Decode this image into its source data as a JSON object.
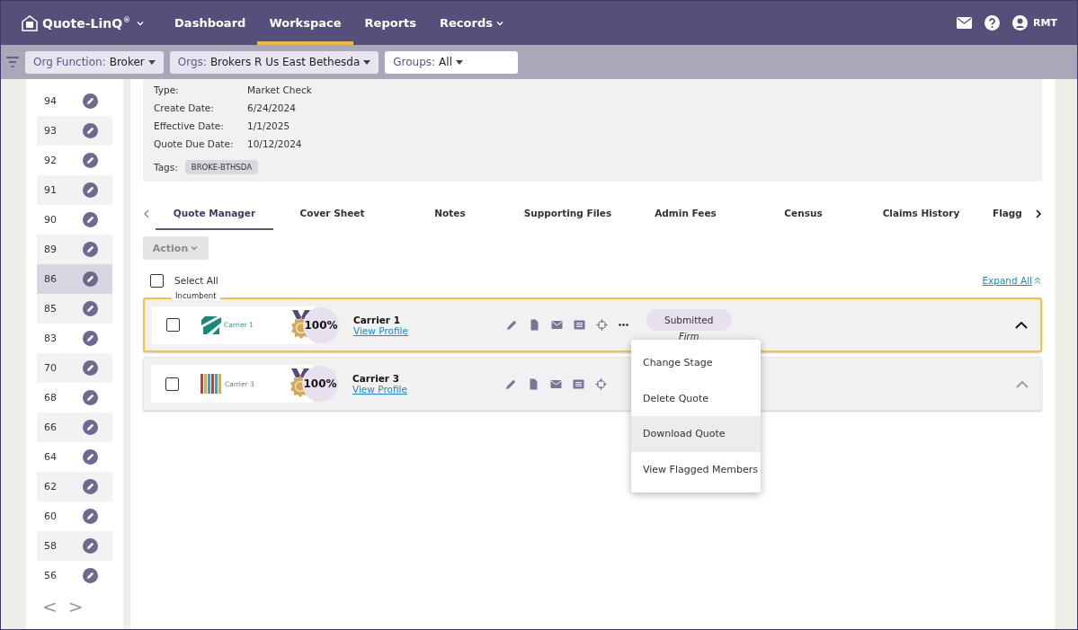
{
  "nav": {
    "brand": "Quote-LinQ",
    "brand_mark": "®",
    "items": [
      {
        "label": "Dashboard",
        "selected": false,
        "dropdown": false
      },
      {
        "label": "Workspace",
        "selected": true,
        "dropdown": false
      },
      {
        "label": "Reports",
        "selected": false,
        "dropdown": false
      },
      {
        "label": "Records",
        "selected": false,
        "dropdown": true
      }
    ],
    "user": "RMT"
  },
  "filters": [
    {
      "label": "Org Function:",
      "value": "Broker",
      "filled": true
    },
    {
      "label": "Orgs:",
      "value": "Brokers R Us East Bethesda",
      "filled": true
    },
    {
      "label": "Groups:",
      "value": "All",
      "filled": false
    }
  ],
  "sidebar": {
    "rows": [
      {
        "number": "94",
        "selected": false
      },
      {
        "number": "93",
        "selected": false
      },
      {
        "number": "92",
        "selected": false
      },
      {
        "number": "91",
        "selected": false
      },
      {
        "number": "90",
        "selected": false
      },
      {
        "number": "89",
        "selected": false
      },
      {
        "number": "86",
        "selected": true
      },
      {
        "number": "85",
        "selected": false
      },
      {
        "number": "83",
        "selected": false
      },
      {
        "number": "70",
        "selected": false
      },
      {
        "number": "68",
        "selected": false
      },
      {
        "number": "66",
        "selected": false
      },
      {
        "number": "64",
        "selected": false
      },
      {
        "number": "62",
        "selected": false
      },
      {
        "number": "60",
        "selected": false
      },
      {
        "number": "58",
        "selected": false
      },
      {
        "number": "56",
        "selected": false
      }
    ],
    "prev": "<",
    "next": ">"
  },
  "details": [
    {
      "label": "Type:",
      "value": "Market Check"
    },
    {
      "label": "Create Date:",
      "value": "6/24/2024"
    },
    {
      "label": "Effective Date:",
      "value": "1/1/2025"
    },
    {
      "label": "Quote Due Date:",
      "value": "10/12/2024"
    }
  ],
  "tags": {
    "label": "Tags:",
    "items": [
      "BROKE-BTHSDA"
    ]
  },
  "tabs": [
    {
      "label": "Quote Manager",
      "selected": true
    },
    {
      "label": "Cover Sheet",
      "selected": false
    },
    {
      "label": "Notes",
      "selected": false
    },
    {
      "label": "Supporting Files",
      "selected": false
    },
    {
      "label": "Admin Fees",
      "selected": false
    },
    {
      "label": "Census",
      "selected": false
    },
    {
      "label": "Claims History",
      "selected": false
    },
    {
      "label": "Flagg",
      "selected": false
    }
  ],
  "action_button": {
    "label": "Action",
    "disabled": true
  },
  "select_all": {
    "label": "Select All",
    "checked": false
  },
  "expand_all": "Expand All",
  "quotes": [
    {
      "badge": "Incumbent",
      "kind": "stripes",
      "logo_text": "Carrier 1",
      "score": "100%",
      "name": "Carrier 1",
      "link": "View Profile",
      "stage": "Submitted",
      "status": "Firm",
      "checked": false,
      "highlighted": true,
      "expanded": true
    },
    {
      "kind": "bars",
      "logo_text": "Carrier 3",
      "score": "100%",
      "name": "Carrier 3",
      "link": "View Profile",
      "checked": false,
      "highlighted": false,
      "expanded": false
    }
  ],
  "menu": {
    "items": [
      {
        "label": "Change Stage",
        "hovered": false
      },
      {
        "label": "Delete Quote",
        "hovered": false
      },
      {
        "label": "Download Quote",
        "hovered": true
      },
      {
        "label": "View Flagged Members",
        "hovered": false
      }
    ]
  }
}
